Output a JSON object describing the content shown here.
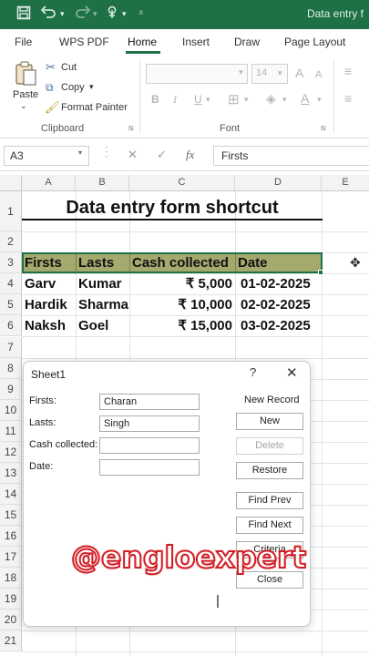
{
  "window": {
    "title": "Data entry f"
  },
  "quick_access": {
    "icons": [
      "save-icon",
      "undo-icon",
      "redo-icon",
      "touch-mode-icon",
      "customize-icon"
    ]
  },
  "tabs": [
    {
      "label": "File",
      "active": false
    },
    {
      "label": "WPS PDF",
      "active": false
    },
    {
      "label": "Home",
      "active": true
    },
    {
      "label": "Insert",
      "active": false
    },
    {
      "label": "Draw",
      "active": false
    },
    {
      "label": "Page Layout",
      "active": false
    }
  ],
  "ribbon": {
    "clipboard": {
      "paste": "Paste",
      "cut": "Cut",
      "copy": "Copy",
      "format_painter": "Format Painter",
      "group_label": "Clipboard"
    },
    "font": {
      "size": "14",
      "bold": "B",
      "italic": "I",
      "underline": "U",
      "font_color": "A",
      "group_label": "Font"
    }
  },
  "formula_bar": {
    "name_box": "A3",
    "fx": "fx",
    "content": "Firsts"
  },
  "sheet": {
    "columns": [
      "A",
      "B",
      "C",
      "D",
      "E"
    ],
    "rows": [
      "1",
      "2",
      "3",
      "4",
      "5",
      "6",
      "7",
      "8",
      "9",
      "10",
      "11",
      "12",
      "13",
      "14",
      "15",
      "16",
      "17",
      "18",
      "19",
      "20",
      "21"
    ],
    "title": "Data entry form shortcut",
    "headers": [
      "Firsts",
      "Lasts",
      "Cash collected",
      "Date"
    ],
    "data": [
      [
        "Garv",
        "Kumar",
        "₹ 5,000",
        "01-02-2025"
      ],
      [
        "Hardik",
        "Sharma",
        "₹ 10,000",
        "02-02-2025"
      ],
      [
        "Naksh",
        "Goel",
        "₹ 15,000",
        "03-02-2025"
      ]
    ]
  },
  "dialog": {
    "title": "Sheet1",
    "help": "?",
    "close": "✕",
    "record_status": "New Record",
    "fields": [
      {
        "label": "Firsts:",
        "value": "Charan"
      },
      {
        "label": "Lasts:",
        "value": "Singh"
      },
      {
        "label": "Cash collected:",
        "value": ""
      },
      {
        "label": "Date:",
        "value": ""
      }
    ],
    "buttons": {
      "new": "New",
      "delete": "Delete",
      "restore": "Restore",
      "find_prev": "Find Prev",
      "find_next": "Find Next",
      "criteria": "Criteria",
      "close": "Close"
    }
  },
  "watermark": "@engloexpert",
  "colors": {
    "accent": "#1e7145",
    "header_fill": "#a4a96e",
    "watermark": "#d11f26"
  }
}
